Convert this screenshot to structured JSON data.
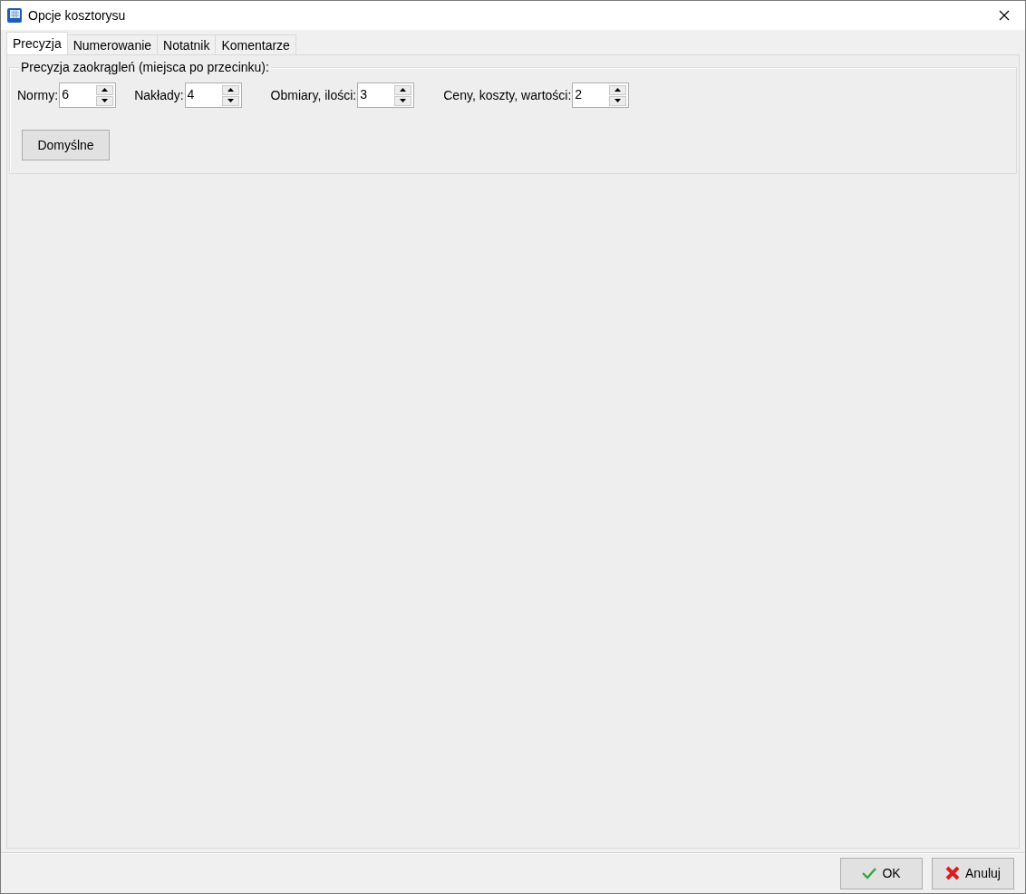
{
  "window": {
    "title": "Opcje kosztorysu"
  },
  "tabs": [
    {
      "label": "Precyzja",
      "selected": true
    },
    {
      "label": "Numerowanie",
      "selected": false
    },
    {
      "label": "Notatnik",
      "selected": false
    },
    {
      "label": "Komentarze",
      "selected": false
    }
  ],
  "group": {
    "title": "Precyzja zaokrągleń (miejsca po przecinku):",
    "spinners": [
      {
        "label": "Normy:",
        "value": "6"
      },
      {
        "label": "Nakłady:",
        "value": "4"
      },
      {
        "label": "Obmiary, ilości:",
        "value": "3"
      },
      {
        "label": "Ceny, koszty, wartości:",
        "value": "2"
      }
    ],
    "default_button": "Domyślne"
  },
  "buttons": [
    {
      "kind": "ok",
      "label": "OK"
    },
    {
      "kind": "cancel",
      "label": "Anuluj"
    }
  ]
}
